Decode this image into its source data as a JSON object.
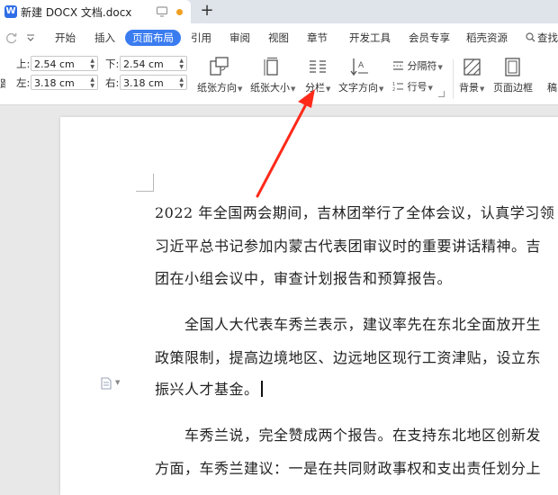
{
  "window": {
    "doc_title": "新建 DOCX 文档.docx",
    "app_logo_letter": "W",
    "new_tab_label": "+"
  },
  "menu": {
    "tabs": [
      {
        "label": "开始"
      },
      {
        "label": "插入"
      },
      {
        "label": "页面布局"
      },
      {
        "label": "引用"
      },
      {
        "label": "审阅"
      },
      {
        "label": "视图"
      },
      {
        "label": "章节"
      },
      {
        "label": "开发工具"
      },
      {
        "label": "会员专享"
      },
      {
        "label": "稻壳资源"
      }
    ],
    "active_tab": "页面布局",
    "search_label": "查找"
  },
  "margins": {
    "top_label": "上:",
    "top_value": "2.54 cm",
    "bottom_label": "下:",
    "bottom_value": "2.54 cm",
    "left_label": "左:",
    "left_value": "3.18 cm",
    "right_label": "右:",
    "right_value": "3.18 cm",
    "cut_label": "距"
  },
  "toolbar": {
    "orientation_label": "纸张方向",
    "size_label": "纸张大小",
    "columns_label": "分栏",
    "text_direction_label": "文字方向",
    "separator_label": "分隔符",
    "line_number_label": "行号",
    "background_label": "背景",
    "page_border_label": "页面边框",
    "cut_label": "稿"
  },
  "document": {
    "lines": [
      "2022 年全国两会期间，吉林团举行了全体会议，认真学习领",
      "习近平总书记参加内蒙古代表团审议时的重要讲话精神。吉",
      "团在小组会议中，审查计划报告和预算报告。",
      "　　全国人大代表车秀兰表示，建议率先在东北全面放开生",
      "政策限制，提高边境地区、边远地区现行工资津贴，设立东",
      "振兴人才基金。",
      "　　车秀兰说，完全赞成两个报告。在支持东北地区创新发",
      "方面，车秀兰建议：一是在共同财政事权和支出责任划分上"
    ]
  },
  "colors": {
    "accent": "#3a7cf0",
    "annotation_arrow": "#ff2a1a",
    "unsaved_dot": "#f0a020"
  }
}
